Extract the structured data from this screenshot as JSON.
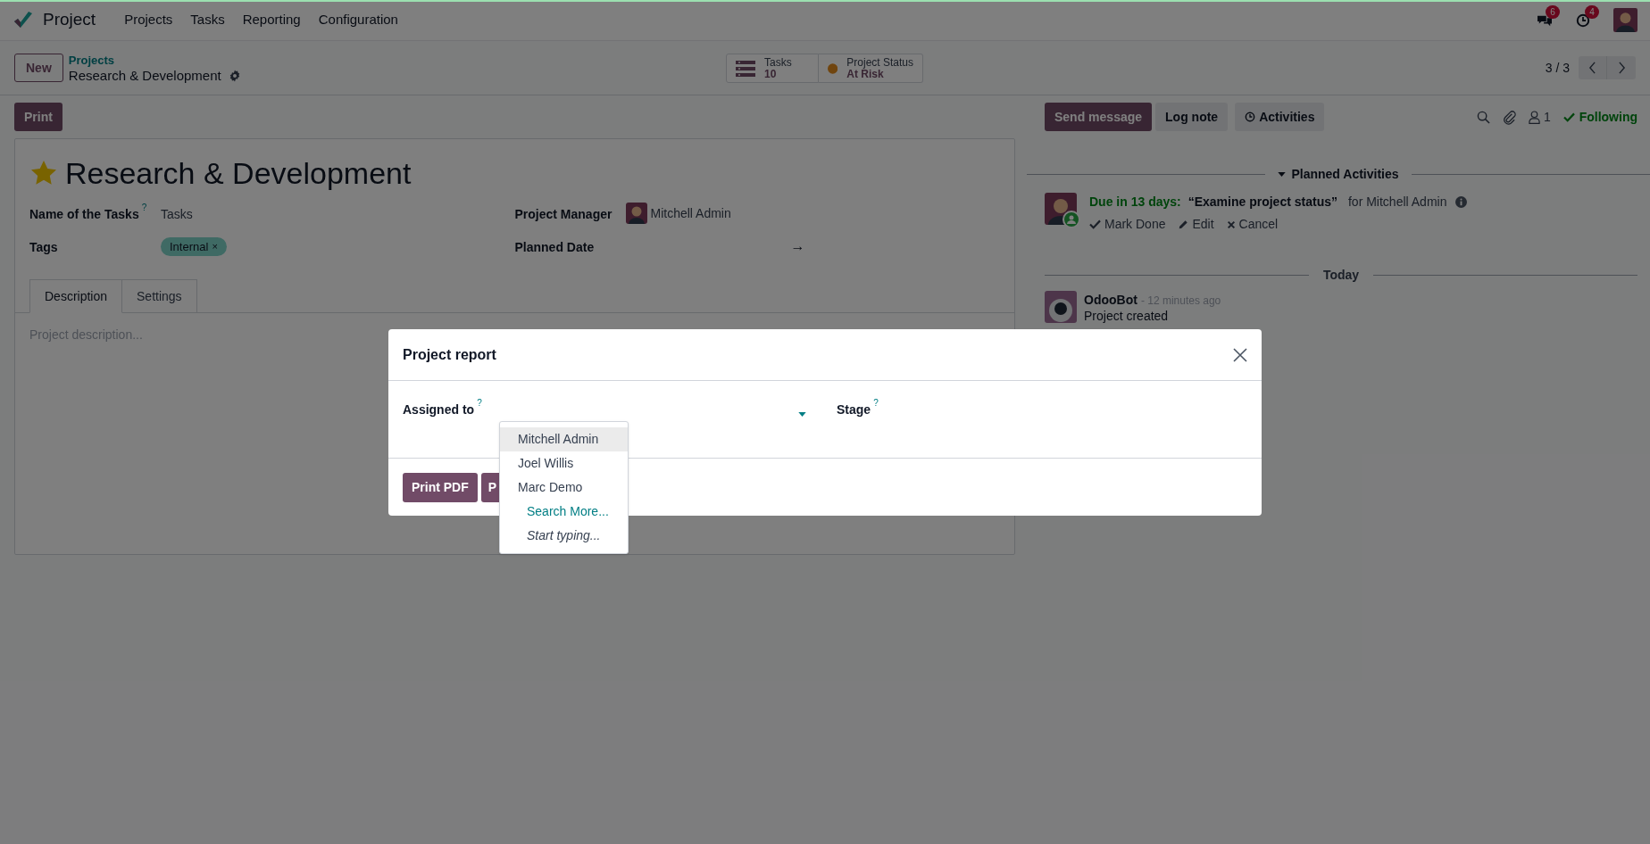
{
  "navbar": {
    "app": "Project",
    "menu": [
      "Projects",
      "Tasks",
      "Reporting",
      "Configuration"
    ],
    "messages_badge": "6",
    "activities_badge": "4"
  },
  "control_panel": {
    "new_button": "New",
    "breadcrumb": "Projects",
    "record": "Research & Development",
    "stat_buttons": [
      {
        "kind": "tasks",
        "label": "Tasks",
        "value": "10"
      },
      {
        "kind": "status",
        "label": "Project Status",
        "value": "At Risk"
      }
    ],
    "pager": "3 / 3"
  },
  "form": {
    "print_button": "Print",
    "favorite": true,
    "title": "Research & Development",
    "left_fields": [
      {
        "kind": "text",
        "label": "Name of the Tasks",
        "help": "?",
        "value": "Tasks"
      },
      {
        "kind": "tags",
        "label": "Tags",
        "tags": [
          "Internal"
        ],
        "remove": "×"
      }
    ],
    "right_fields": [
      {
        "kind": "user",
        "label": "Project Manager",
        "value": "Mitchell Admin"
      },
      {
        "kind": "daterange",
        "label": "Planned Date",
        "value": "→"
      }
    ],
    "tabs": [
      {
        "label": "Description",
        "selected": true
      },
      {
        "label": "Settings",
        "selected": false
      }
    ],
    "description_placeholder": "Project description..."
  },
  "chatter": {
    "buttons": [
      {
        "kind": "primary",
        "label": "Send message"
      },
      {
        "kind": "secondary",
        "label": "Log note"
      },
      {
        "kind": "activities",
        "label": "Activities"
      }
    ],
    "followers_count": "1",
    "following": "Following",
    "planned_heading": "Planned Activities",
    "activities": [
      {
        "due": "Due in 13 days:",
        "summary": "“Examine project status”",
        "assignee": "for Mitchell Admin",
        "actions": [
          {
            "kind": "done",
            "label": "Mark Done"
          },
          {
            "kind": "edit",
            "label": "Edit"
          },
          {
            "kind": "cancel",
            "label": "Cancel"
          }
        ]
      }
    ],
    "date_separator": "Today",
    "messages": [
      {
        "author": "OdooBot",
        "time": "- 12 minutes ago",
        "body": "Project created"
      }
    ]
  },
  "modal": {
    "title": "Project report",
    "fields": [
      {
        "kind": "many2one",
        "label": "Assigned to",
        "help": "?"
      },
      {
        "kind": "selection",
        "label": "Stage",
        "help": "?"
      }
    ],
    "footer_buttons": [
      "Print PDF",
      "P"
    ],
    "dropdown": [
      {
        "kind": "option",
        "label": "Mitchell Admin",
        "selected": true
      },
      {
        "kind": "option",
        "label": "Joel Willis",
        "selected": false
      },
      {
        "kind": "option",
        "label": "Marc Demo",
        "selected": false
      },
      {
        "kind": "search",
        "label": "Search More...",
        "selected": false
      },
      {
        "kind": "hint",
        "label": "Start typing...",
        "selected": false
      }
    ]
  }
}
